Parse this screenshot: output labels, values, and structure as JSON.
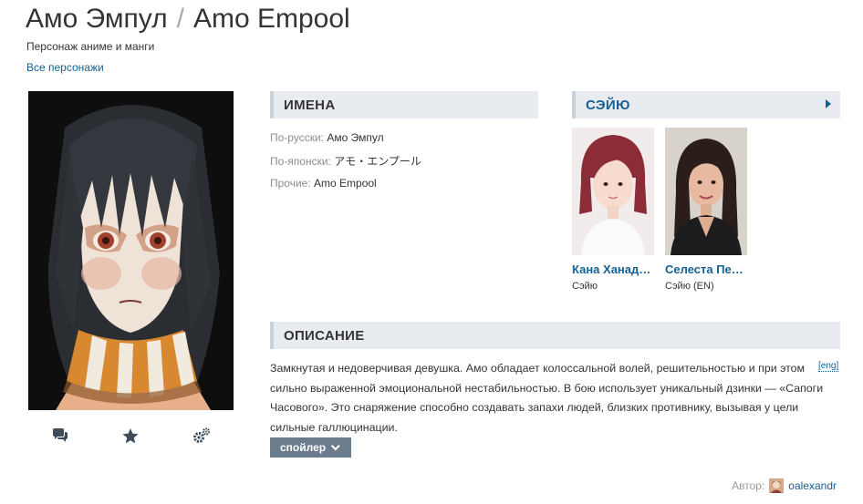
{
  "header": {
    "title_ru": "Амо Эмпул",
    "separator": "/",
    "title_en": "Amo Empool",
    "subtitle": "Персонаж аниме и манги",
    "back_link": "Все персонажи"
  },
  "poster": {
    "actions": [
      {
        "icon": "comments-icon"
      },
      {
        "icon": "star-icon"
      },
      {
        "icon": "gears-icon"
      }
    ]
  },
  "names": {
    "heading": "ИМЕНА",
    "russian_label": "По-русски:",
    "russian_value": "Амо Эмпул",
    "japanese_label": "По-японски:",
    "japanese_value": "アモ・エンプール",
    "other_label": "Прочие:",
    "other_value": "Amo Empool"
  },
  "seiyu": {
    "heading": "СЭЙЮ",
    "actors": [
      {
        "name": "Кана Ханад…",
        "role": "Сэйю"
      },
      {
        "name": "Селеста Пе…",
        "role": "Сэйю (EN)"
      }
    ]
  },
  "description": {
    "heading": "ОПИСАНИЕ",
    "text": "Замкнутая и недоверчивая девушка. Амо обладает колоссальной волей, решительностью и при этом сильно выраженной эмоциональной нестабильностью. В бою использует уникальный дзинки — «Сапоги Часового». Это снаряжение способно создавать запахи людей, близких противнику, вызывая у цели сильные галлюцинации.",
    "eng_link": "[eng]",
    "spoiler_button": "спойлер"
  },
  "footer": {
    "author_label": "Автор:",
    "author_name": "oalexandr"
  },
  "colors": {
    "link": "#176093",
    "section_bg": "#e8ecf1",
    "spoiler_bg": "#6b7c8c",
    "text": "#343434",
    "muted": "#8d8d8d"
  }
}
